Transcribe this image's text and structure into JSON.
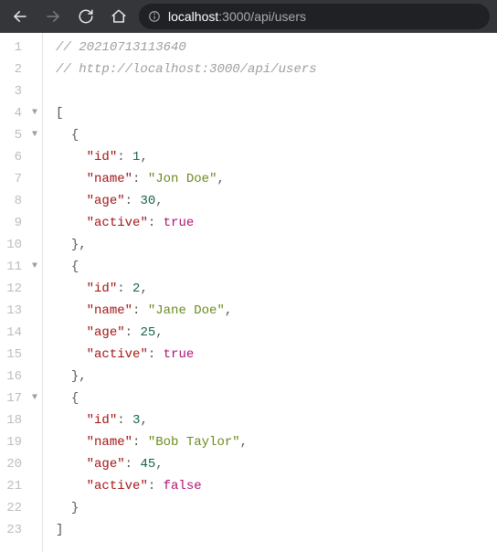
{
  "toolbar": {
    "url_host": "localhost",
    "url_port_path": ":3000/api/users"
  },
  "gutter": {
    "lines": [
      "1",
      "2",
      "3",
      "4",
      "5",
      "6",
      "7",
      "8",
      "9",
      "10",
      "11",
      "12",
      "13",
      "14",
      "15",
      "16",
      "17",
      "18",
      "19",
      "20",
      "21",
      "22",
      "23"
    ],
    "fold_marker": "▼"
  },
  "code": {
    "comment_prefix": "// ",
    "comment1": "20210713113640",
    "comment2": "http://localhost:3000/api/users",
    "open_bracket": "[",
    "close_bracket": "]",
    "open_brace": "{",
    "close_brace_comma": "},",
    "close_brace": "}",
    "colon": ": ",
    "comma": ",",
    "q": "\"",
    "keys": {
      "id": "id",
      "name": "name",
      "age": "age",
      "active": "active"
    },
    "users": [
      {
        "id": "1",
        "name": "Jon Doe",
        "age": "30",
        "active": "true"
      },
      {
        "id": "2",
        "name": "Jane Doe",
        "age": "25",
        "active": "true"
      },
      {
        "id": "3",
        "name": "Bob Taylor",
        "age": "45",
        "active": "false"
      }
    ]
  }
}
